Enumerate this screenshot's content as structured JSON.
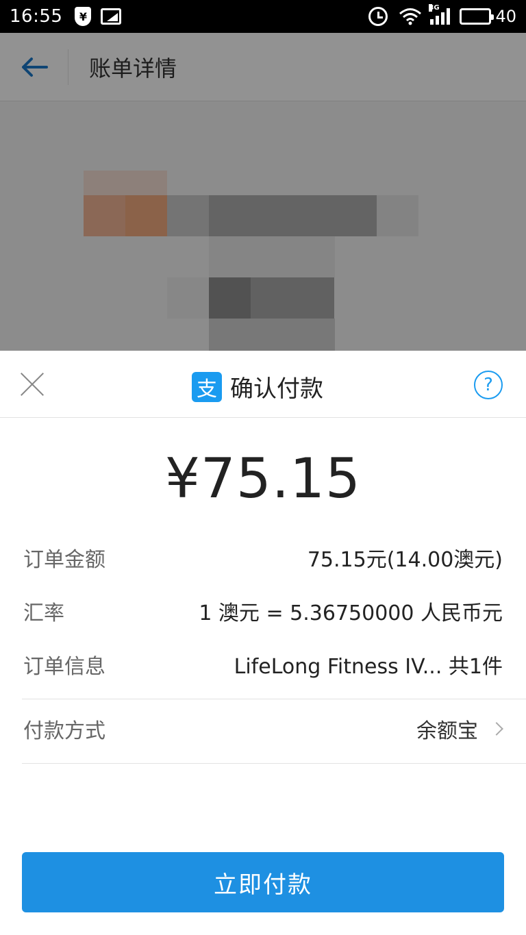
{
  "status_bar": {
    "time": "16:55",
    "network": "3G",
    "battery": "40"
  },
  "background": {
    "title": "账单详情"
  },
  "sheet": {
    "title": "确认付款",
    "help": "?",
    "logo_glyph": "支",
    "amount": "¥75.15",
    "details": [
      {
        "label": "订单金额",
        "value": "75.15元(14.00澳元)"
      },
      {
        "label": "汇率",
        "value": "1 澳元 = 5.36750000 人民币元"
      },
      {
        "label": "订单信息",
        "value": "LifeLong Fitness IV... 共1件"
      }
    ],
    "payment_method": {
      "label": "付款方式",
      "value": "余额宝"
    },
    "pay_button": "立即付款"
  },
  "colors": {
    "accent": "#1e90e2",
    "logo": "#1a9bf0"
  }
}
